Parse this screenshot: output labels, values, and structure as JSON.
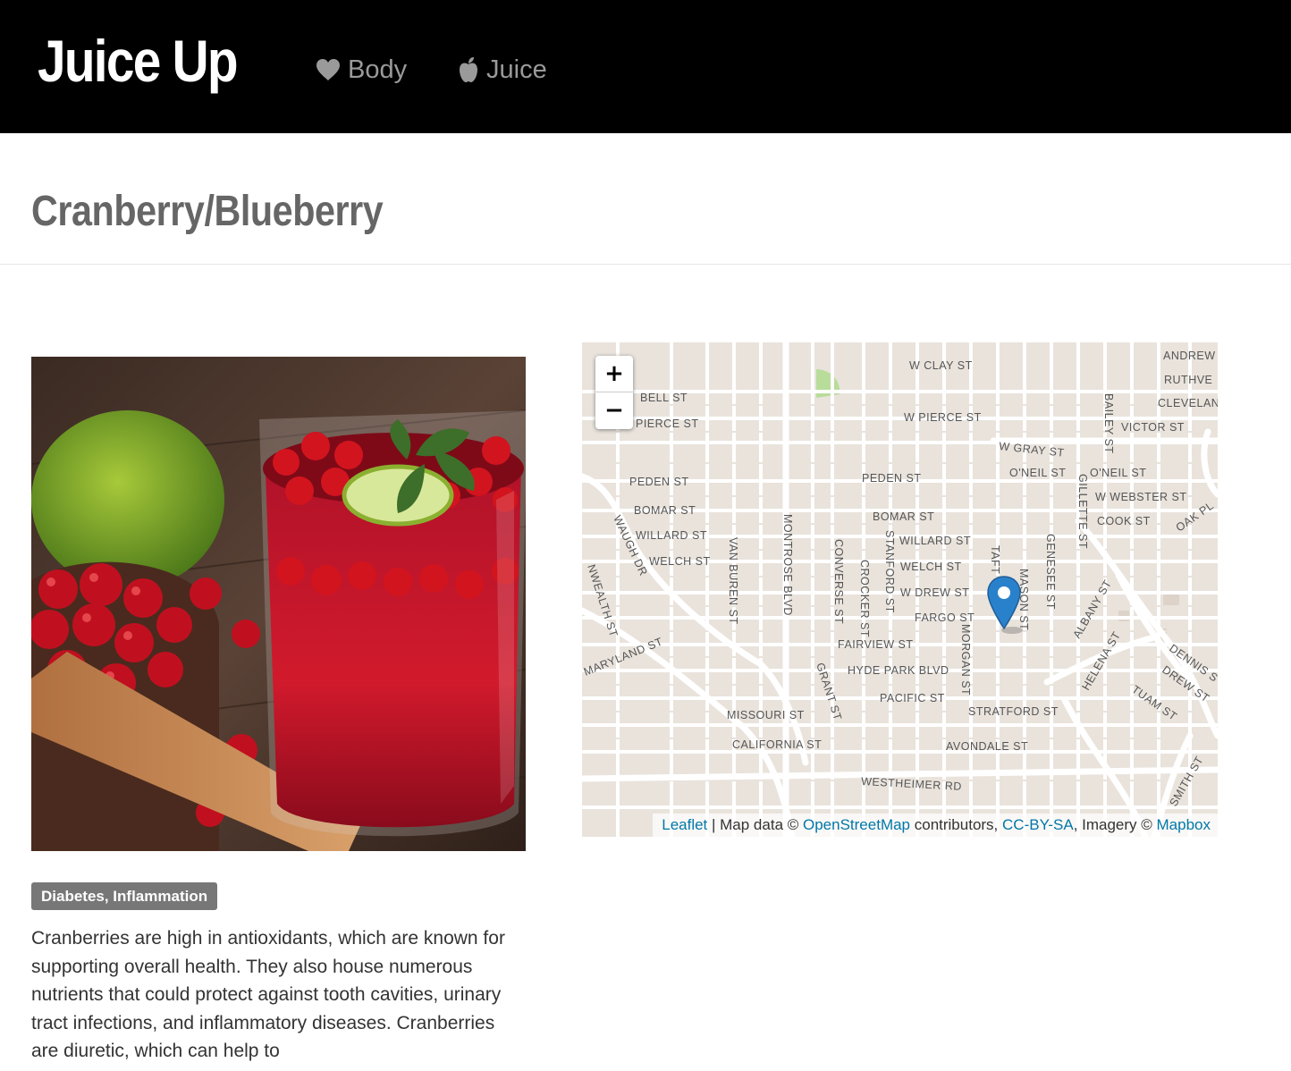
{
  "navbar": {
    "brand": "Juice Up",
    "items": [
      {
        "label": "Body",
        "icon": "heart-icon"
      },
      {
        "label": "Juice",
        "icon": "apple-icon"
      }
    ]
  },
  "page": {
    "title": "Cranberry/Blueberry"
  },
  "juice": {
    "tag": "Diabetes, Inflammation",
    "description": "Cranberries are high in antioxidants, which are known for supporting overall health. They also house numerous nutrients that could protect against tooth cavities, urinary tract infections, and inflammatory diseases. Cranberries are diuretic, which can help to"
  },
  "map": {
    "zoom_in": "+",
    "zoom_out": "−",
    "attribution": {
      "leaflet": "Leaflet",
      "sep1": " | Map data © ",
      "osm": "OpenStreetMap",
      "sep2": " contributors, ",
      "license": "CC-BY-SA",
      "sep3": ", Imagery © ",
      "mapbox": "Mapbox"
    },
    "street_labels": {
      "w_clay": "W CLAY ST",
      "bell": "BELL ST",
      "pierce": "PIERCE ST",
      "w_pierce": "W PIERCE ST",
      "w_gray": "W GRAY ST",
      "oneil": "O'NEIL ST",
      "oneil2": "O'NEIL ST",
      "w_webster": "W WEBSTER ST",
      "cook": "COOK ST",
      "peden1": "PEDEN ST",
      "peden2": "PEDEN ST",
      "bomar1": "BOMAR ST",
      "bomar2": "BOMAR ST",
      "willard1": "WILLARD ST",
      "willard2": "WILLARD ST",
      "welch1": "WELCH ST",
      "welch2": "WELCH ST",
      "w_drew": "W DREW ST",
      "fargo": "FARGO ST",
      "fairview": "FAIRVIEW ST",
      "hyde_park": "HYDE PARK BLVD",
      "pacific": "PACIFIC ST",
      "stratford": "STRATFORD ST",
      "missouri": "MISSOURI ST",
      "california": "CALIFORNIA ST",
      "avondale": "AVONDALE ST",
      "westheimer": "WESTHEIMER RD",
      "andrews": "ANDREW",
      "ruthven": "RUTHVE",
      "cleveland": "CLEVELAN",
      "victor": "VICTOR ST",
      "oak_pl": "OAK PL",
      "montrose": "MONTROSE BLVD",
      "van_buren": "VAN BUREN ST",
      "waugh": "WAUGH DR",
      "converse": "CONVERSE ST",
      "crocker": "CROCKER ST",
      "stanford": "STANFORD ST",
      "morgan": "MORGAN ST",
      "taft": "TAFT",
      "mason": "MASON ST",
      "genesee": "GENESEE ST",
      "gillette": "GILLETTE ST",
      "bailey": "BAILEY ST",
      "albany": "ALBANY ST",
      "helena": "HELENA ST",
      "dennis": "DENNIS S",
      "drew": "DREW ST",
      "tuam": "TUAM ST",
      "smith": "SMITH ST",
      "grant": "GRANT ST",
      "maryland": "MARYLAND ST",
      "commonwealth": "NWEALTH ST"
    }
  },
  "colors": {
    "navbar_bg": "#000000",
    "brand_text": "#ffffff",
    "nav_text": "#9a9a9a",
    "title_text": "#666666",
    "tag_bg": "#777777",
    "link": "#0078a8",
    "marker": "#2a81cb"
  }
}
